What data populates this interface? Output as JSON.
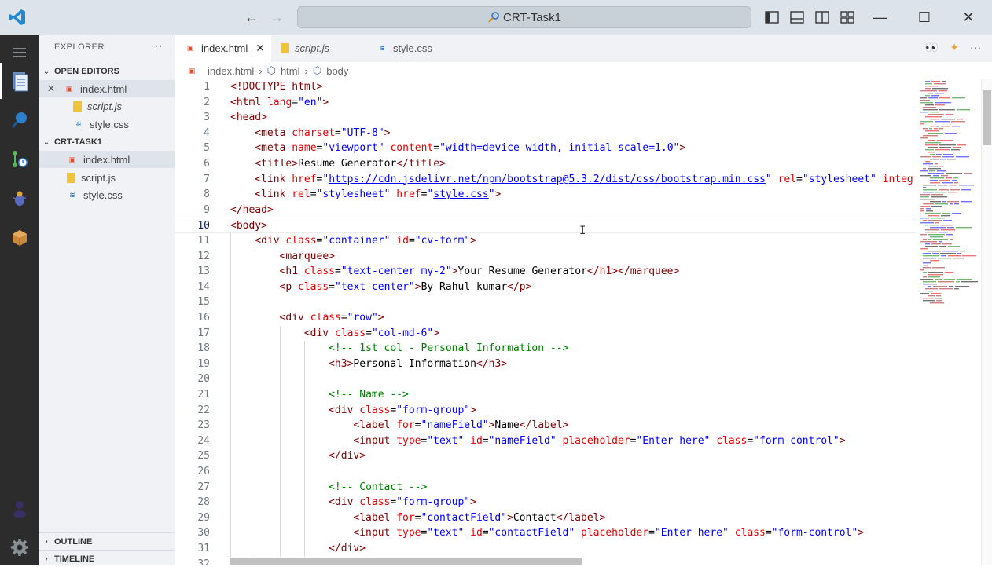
{
  "window": {
    "search_text": "CRT-Task1"
  },
  "sidebar": {
    "title": "EXPLORER",
    "open_editors_label": "OPEN EDITORS",
    "open_editors": [
      {
        "name": "index.html",
        "type": "html"
      },
      {
        "name": "script.js",
        "type": "js"
      },
      {
        "name": "style.css",
        "type": "css"
      }
    ],
    "folder_label": "CRT-TASK1",
    "folder_files": [
      {
        "name": "index.html",
        "type": "html"
      },
      {
        "name": "script.js",
        "type": "js"
      },
      {
        "name": "style.css",
        "type": "css"
      }
    ],
    "outline_label": "OUTLINE",
    "timeline_label": "TIMELINE"
  },
  "tabs": [
    {
      "label": "index.html",
      "type": "html",
      "active": true
    },
    {
      "label": "script.js",
      "type": "js",
      "active": false
    },
    {
      "label": "style.css",
      "type": "css",
      "active": false
    }
  ],
  "breadcrumb": [
    "index.html",
    "html",
    "body"
  ],
  "editor": {
    "current_line": 10,
    "lines": [
      {
        "n": "1",
        "indent": 0,
        "html": "<span class='t-tag'>&lt;!DOCTYPE html&gt;</span>"
      },
      {
        "n": "2",
        "indent": 0,
        "html": "<span class='t-tag'>&lt;html </span><span class='t-attr'>lang</span><span class='t-txt'>=</span><span class='t-str'>\"en\"</span><span class='t-tag'>&gt;</span>"
      },
      {
        "n": "3",
        "indent": 0,
        "html": "<span class='t-tag'>&lt;head&gt;</span>"
      },
      {
        "n": "4",
        "indent": 1,
        "html": "<span class='t-tag'>&lt;meta </span><span class='t-attr'>charset</span><span class='t-txt'>=</span><span class='t-str'>\"UTF-8\"</span><span class='t-tag'>&gt;</span>"
      },
      {
        "n": "5",
        "indent": 1,
        "html": "<span class='t-tag'>&lt;meta </span><span class='t-attr'>name</span><span class='t-txt'>=</span><span class='t-str'>\"viewport\"</span> <span class='t-attr'>content</span><span class='t-txt'>=</span><span class='t-str'>\"width=device-width, initial-scale=1.0\"</span><span class='t-tag'>&gt;</span>"
      },
      {
        "n": "6",
        "indent": 1,
        "html": "<span class='t-tag'>&lt;title&gt;</span><span class='t-txt'>Resume Generator</span><span class='t-tag'>&lt;/title&gt;</span>"
      },
      {
        "n": "7",
        "indent": 1,
        "html": "<span class='t-tag'>&lt;link </span><span class='t-attr'>href</span><span class='t-txt'>=</span><span class='t-str'>\"</span><span class='t-link'>https://cdn.jsdelivr.net/npm/bootstrap@5.3.2/dist/css/bootstrap.min.css</span><span class='t-str'>\"</span> <span class='t-attr'>rel</span><span class='t-txt'>=</span><span class='t-str'>\"stylesheet\"</span> <span class='t-attr'>integ</span>"
      },
      {
        "n": "8",
        "indent": 1,
        "html": "<span class='t-tag'>&lt;link </span><span class='t-attr'>rel</span><span class='t-txt'>=</span><span class='t-str'>\"stylesheet\"</span> <span class='t-attr'>href</span><span class='t-txt'>=</span><span class='t-str'>\"</span><span class='t-link'>style.css</span><span class='t-str'>\"</span><span class='t-tag'>&gt;</span>"
      },
      {
        "n": "9",
        "indent": 0,
        "html": "<span class='t-tag'>&lt;/head&gt;</span>"
      },
      {
        "n": "10",
        "indent": 0,
        "html": "<span class='t-tag'>&lt;body&gt;</span>"
      },
      {
        "n": "11",
        "indent": 1,
        "html": "<span class='t-tag'>&lt;div </span><span class='t-attr'>class</span><span class='t-txt'>=</span><span class='t-str'>\"container\"</span> <span class='t-attr'>id</span><span class='t-txt'>=</span><span class='t-str'>\"cv-form\"</span><span class='t-tag'>&gt;</span>"
      },
      {
        "n": "12",
        "indent": 2,
        "html": "<span class='t-tag'>&lt;marquee&gt;</span>"
      },
      {
        "n": "13",
        "indent": 2,
        "html": "<span class='t-tag'>&lt;h1 </span><span class='t-attr'>class</span><span class='t-txt'>=</span><span class='t-str'>\"text-center my-2\"</span><span class='t-tag'>&gt;</span><span class='t-txt'>Your Resume Generator</span><span class='t-tag'>&lt;/h1&gt;&lt;/marquee&gt;</span>"
      },
      {
        "n": "14",
        "indent": 2,
        "html": "<span class='t-tag'>&lt;p </span><span class='t-attr'>class</span><span class='t-txt'>=</span><span class='t-str'>\"text-center\"</span><span class='t-tag'>&gt;</span><span class='t-txt'>By Rahul kumar</span><span class='t-tag'>&lt;/p&gt;</span>"
      },
      {
        "n": "15",
        "indent": 0,
        "html": ""
      },
      {
        "n": "16",
        "indent": 2,
        "html": "<span class='t-tag'>&lt;div </span><span class='t-attr'>class</span><span class='t-txt'>=</span><span class='t-str'>\"row\"</span><span class='t-tag'>&gt;</span>"
      },
      {
        "n": "17",
        "indent": 3,
        "html": "<span class='t-tag'>&lt;div </span><span class='t-attr'>class</span><span class='t-txt'>=</span><span class='t-str'>\"col-md-6\"</span><span class='t-tag'>&gt;</span>"
      },
      {
        "n": "18",
        "indent": 4,
        "html": "<span class='t-com'>&lt;!-- 1st col - Personal Information --&gt;</span>"
      },
      {
        "n": "19",
        "indent": 4,
        "html": "<span class='t-tag'>&lt;h3&gt;</span><span class='t-txt'>Personal Information</span><span class='t-tag'>&lt;/h3&gt;</span>"
      },
      {
        "n": "20",
        "indent": 0,
        "html": ""
      },
      {
        "n": "21",
        "indent": 4,
        "html": "<span class='t-com'>&lt;!-- Name --&gt;</span>"
      },
      {
        "n": "22",
        "indent": 4,
        "html": "<span class='t-tag'>&lt;div </span><span class='t-attr'>class</span><span class='t-txt'>=</span><span class='t-str'>\"form-group\"</span><span class='t-tag'>&gt;</span>"
      },
      {
        "n": "23",
        "indent": 5,
        "html": "<span class='t-tag'>&lt;label </span><span class='t-attr'>for</span><span class='t-txt'>=</span><span class='t-str'>\"nameField\"</span><span class='t-tag'>&gt;</span><span class='t-txt'>Name</span><span class='t-tag'>&lt;/label&gt;</span>"
      },
      {
        "n": "24",
        "indent": 5,
        "html": "<span class='t-tag'>&lt;input </span><span class='t-attr'>type</span><span class='t-txt'>=</span><span class='t-str'>\"text\"</span> <span class='t-attr'>id</span><span class='t-txt'>=</span><span class='t-str'>\"nameField\"</span> <span class='t-attr'>placeholder</span><span class='t-txt'>=</span><span class='t-str'>\"Enter here\"</span> <span class='t-attr'>class</span><span class='t-txt'>=</span><span class='t-str'>\"form-control\"</span><span class='t-tag'>&gt;</span>"
      },
      {
        "n": "25",
        "indent": 4,
        "html": "<span class='t-tag'>&lt;/div&gt;</span>"
      },
      {
        "n": "26",
        "indent": 0,
        "html": ""
      },
      {
        "n": "27",
        "indent": 4,
        "html": "<span class='t-com'>&lt;!-- Contact --&gt;</span>"
      },
      {
        "n": "28",
        "indent": 4,
        "html": "<span class='t-tag'>&lt;div </span><span class='t-attr'>class</span><span class='t-txt'>=</span><span class='t-str'>\"form-group\"</span><span class='t-tag'>&gt;</span>"
      },
      {
        "n": "29",
        "indent": 5,
        "html": "<span class='t-tag'>&lt;label </span><span class='t-attr'>for</span><span class='t-txt'>=</span><span class='t-str'>\"contactField\"</span><span class='t-tag'>&gt;</span><span class='t-txt'>Contact</span><span class='t-tag'>&lt;/label&gt;</span>"
      },
      {
        "n": "30",
        "indent": 5,
        "html": "<span class='t-tag'>&lt;input </span><span class='t-attr'>type</span><span class='t-txt'>=</span><span class='t-str'>\"text\"</span> <span class='t-attr'>id</span><span class='t-txt'>=</span><span class='t-str'>\"contactField\"</span> <span class='t-attr'>placeholder</span><span class='t-txt'>=</span><span class='t-str'>\"Enter here\"</span> <span class='t-attr'>class</span><span class='t-txt'>=</span><span class='t-str'>\"form-control\"</span><span class='t-tag'>&gt;</span>"
      },
      {
        "n": "31",
        "indent": 4,
        "html": "<span class='t-tag'>&lt;/div&gt;</span>"
      },
      {
        "n": "32",
        "indent": 0,
        "html": ""
      }
    ]
  }
}
